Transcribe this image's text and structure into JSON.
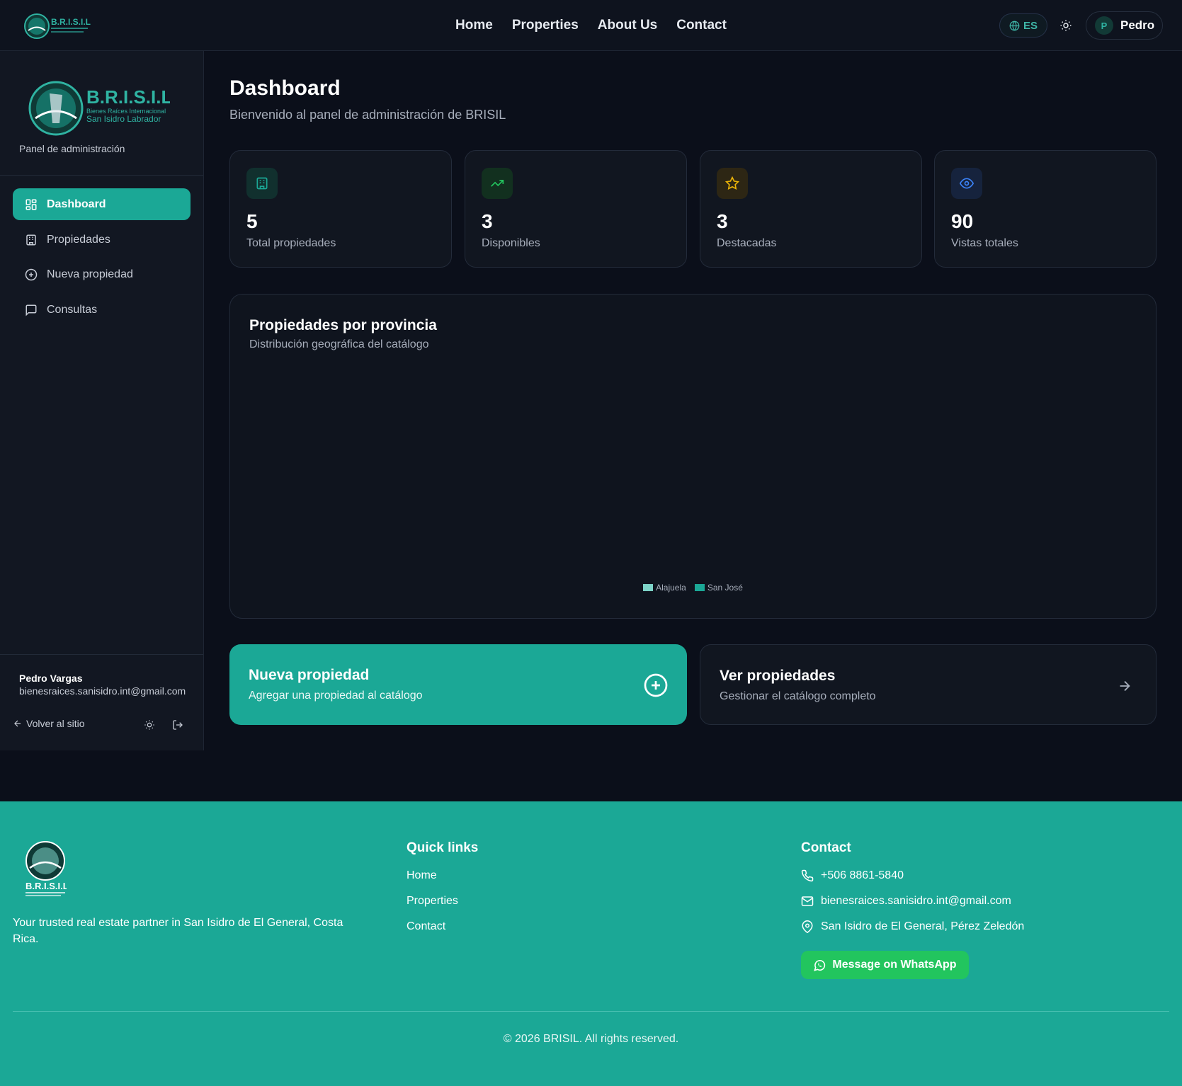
{
  "topnav": {
    "links": [
      "Home",
      "Properties",
      "About Us",
      "Contact"
    ],
    "language": "ES",
    "user_initial": "P",
    "user_name": "Pedro"
  },
  "sidebar": {
    "brand_name": "B.R.I.S.I.L",
    "brand_line1": "Bienes Raíces Internacional",
    "brand_line2": "San Isidro Labrador",
    "panel_label": "Panel de administración",
    "items": [
      {
        "label": "Dashboard",
        "icon": "grid-icon",
        "active": true
      },
      {
        "label": "Propiedades",
        "icon": "building-icon",
        "active": false
      },
      {
        "label": "Nueva propiedad",
        "icon": "plus-circle-icon",
        "active": false
      },
      {
        "label": "Consultas",
        "icon": "message-icon",
        "active": false
      }
    ],
    "user_name": "Pedro Vargas",
    "user_email": "bienesraices.sanisidro.int@gmail.com",
    "back_label": "Volver al sitio"
  },
  "main": {
    "title": "Dashboard",
    "subtitle": "Bienvenido al panel de administración de BRISIL",
    "stats": [
      {
        "value": "5",
        "label": "Total propiedades",
        "icon": "building-icon",
        "color": "#1ba896",
        "bg": "#11302e"
      },
      {
        "value": "3",
        "label": "Disponibles",
        "icon": "trending-up-icon",
        "color": "#22c55e",
        "bg": "#12301f"
      },
      {
        "value": "3",
        "label": "Destacadas",
        "icon": "star-icon",
        "color": "#eab308",
        "bg": "#2d2614"
      },
      {
        "value": "90",
        "label": "Vistas totales",
        "icon": "eye-icon",
        "color": "#3b82f6",
        "bg": "#16233d"
      }
    ],
    "chart": {
      "title": "Propiedades por provincia",
      "subtitle": "Distribución geográfica del catálogo",
      "legend": [
        {
          "name": "Alajuela",
          "color": "#7dd3c8"
        },
        {
          "name": "San José",
          "color": "#1ba896"
        }
      ]
    },
    "actions": [
      {
        "title": "Nueva propiedad",
        "subtitle": "Agregar una propiedad al catálogo",
        "icon": "plus-circle-icon"
      },
      {
        "title": "Ver propiedades",
        "subtitle": "Gestionar el catálogo completo",
        "icon": "arrow-right-icon"
      }
    ]
  },
  "footer": {
    "brand_name": "B.R.I.S.I.L",
    "tagline": "Your trusted real estate partner in San Isidro de El General, Costa Rica.",
    "quick_links_title": "Quick links",
    "quick_links": [
      "Home",
      "Properties",
      "Contact"
    ],
    "contact_title": "Contact",
    "phone": "+506 8861-5840",
    "email": "bienesraices.sanisidro.int@gmail.com",
    "address": "San Isidro de El General, Pérez Zeledón",
    "whatsapp_label": "Message on WhatsApp",
    "copyright": "© 2026 BRISIL. All rights reserved."
  }
}
